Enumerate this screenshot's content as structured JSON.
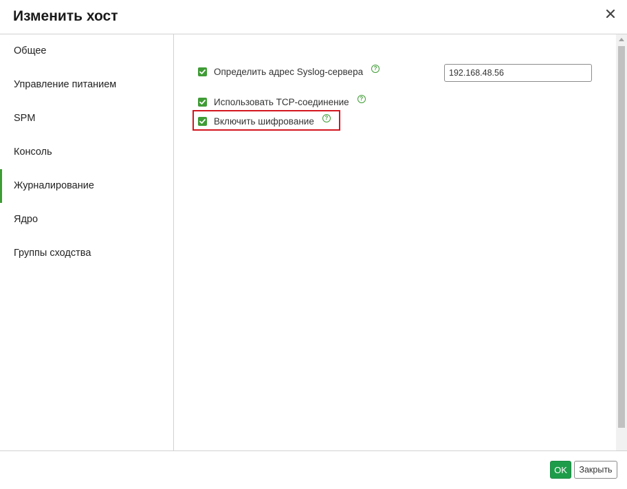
{
  "dialog": {
    "title": "Изменить хост",
    "close_icon": "close-icon"
  },
  "sidebar": {
    "items": [
      {
        "label": "Общее",
        "active": false
      },
      {
        "label": "Управление питанием",
        "active": false
      },
      {
        "label": "SPM",
        "active": false
      },
      {
        "label": "Консоль",
        "active": false
      },
      {
        "label": "Журналирование",
        "active": true
      },
      {
        "label": "Ядро",
        "active": false
      },
      {
        "label": "Группы сходства",
        "active": false
      }
    ]
  },
  "logging": {
    "syslog_address": {
      "label": "Определить адрес Syslog-сервера",
      "checked": true,
      "value": "192.168.48.56",
      "help_icon": "help-icon"
    },
    "use_tcp": {
      "label": "Использовать TCP-соединение",
      "checked": true,
      "help_icon": "help-icon"
    },
    "encryption": {
      "label": "Включить шифрование",
      "checked": true,
      "help_icon": "help-icon"
    }
  },
  "footer": {
    "ok_label": "OK",
    "close_label": "Закрыть"
  },
  "colors": {
    "accent": "#3f9c35",
    "ok_button": "#1f9c4a",
    "highlight": "#d3141d"
  }
}
